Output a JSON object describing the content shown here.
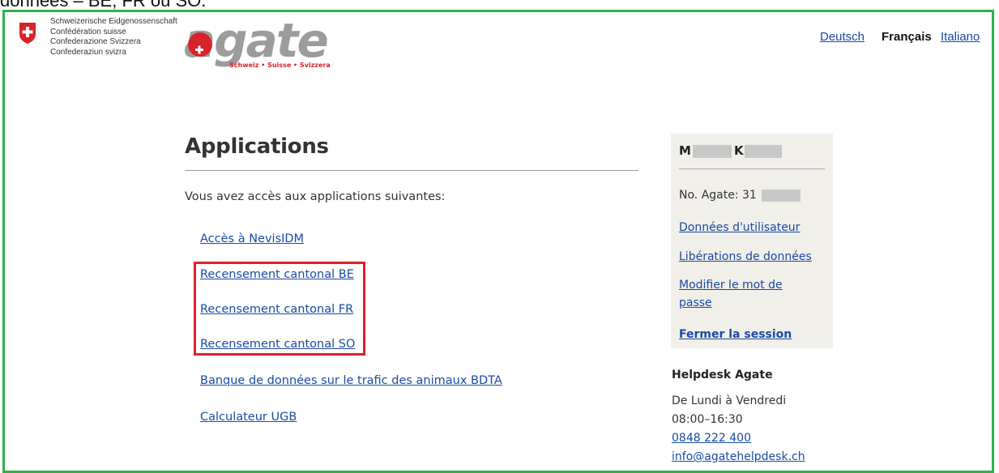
{
  "caption": "données – BE, FR ou SO.",
  "header": {
    "confederation": [
      "Schweizerische Eidgenossenschaft",
      "Confédération suisse",
      "Confederazione Svizzera",
      "Confederaziun svizra"
    ],
    "logo_text": "agate",
    "logo_tagline": "Schweiz • Suisse • Svizzera",
    "languages": [
      {
        "label": "Deutsch",
        "active": false
      },
      {
        "label": "Français",
        "active": true
      },
      {
        "label": "Italiano",
        "active": false
      }
    ]
  },
  "main": {
    "title": "Applications",
    "intro": "Vous avez accès aux applications suivantes:",
    "apps": [
      "Accès à NevisIDM",
      "Recensement cantonal BE",
      "Recensement cantonal FR",
      "Recensement cantonal SO",
      "Banque de données sur le trafic des animaux BDTA",
      "Calculateur UGB"
    ]
  },
  "user_panel": {
    "name_initial_1": "M",
    "name_initial_2": "K",
    "agate_no": "No. Agate: 31",
    "links": [
      "Données d'utilisateur",
      "Libérations de données",
      "Modifier le mot de",
      "passe"
    ],
    "logout": "Fermer la session"
  },
  "helpdesk": {
    "title": "Helpdesk Agate",
    "hours_days": "De Lundi à Vendredi",
    "hours_time": "08:00–16:30",
    "phone": "0848 222 400",
    "email": "info@agatehelpdesk.ch"
  },
  "colors": {
    "frame": "#2fb24a",
    "highlight": "#e0202a",
    "link": "#1a4aa3",
    "brand_red": "#d8232a"
  }
}
